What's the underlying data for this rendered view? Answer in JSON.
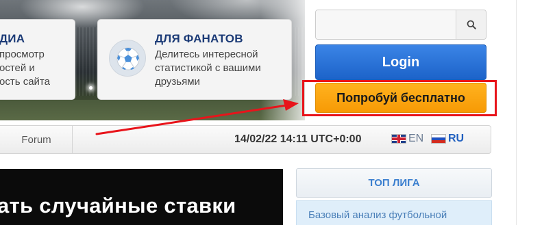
{
  "cards": {
    "left": {
      "title": "ДИА",
      "lines": [
        "просмотр",
        "остей и",
        "ость сайта"
      ]
    },
    "right": {
      "title": "ДЛЯ ФАНАТОВ",
      "description": "Делитесь интересной статистикой с вашими друзьями",
      "icon": "football-icon"
    }
  },
  "search": {
    "placeholder": "",
    "value": "",
    "icon": "search-icon"
  },
  "buttons": {
    "login": "Login",
    "try_free": "Попробуй бесплатно"
  },
  "nav": {
    "forum": "Forum",
    "datetime": "14/02/22 14:11 UTC+0:00",
    "languages": [
      {
        "code": "EN",
        "flag": "uk-flag-icon",
        "active": false
      },
      {
        "code": "RU",
        "flag": "ru-flag-icon",
        "active": true
      }
    ]
  },
  "banner": {
    "text": "ать случайные ставки"
  },
  "widget": {
    "title": "ТОП ЛИГА",
    "body": "Базовый анализ футбольной"
  },
  "colors": {
    "brand_blue": "#1c63c9",
    "accent_orange": "#f79a05",
    "highlight_red": "#e8141b",
    "title_navy": "#1b3a76",
    "link_blue": "#3b7fcf"
  }
}
